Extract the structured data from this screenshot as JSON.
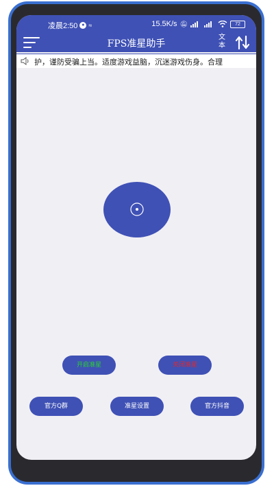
{
  "status_bar": {
    "time": "凌晨2:50",
    "network_speed": "15.5K/s",
    "battery": "72",
    "icons": [
      "qq-notification-icon",
      "app-notification-icon",
      "silent-icon",
      "signal-icon",
      "wifi-icon",
      "battery-icon"
    ]
  },
  "app_bar": {
    "title": "FPS准星助手",
    "text_button_line1": "文",
    "text_button_line2": "本",
    "icons": [
      "menu-icon",
      "swap-vertical-icon"
    ]
  },
  "notice": {
    "text": "护，谨防受骗上当。适度游戏益脑，沉迷游戏伤身。合理"
  },
  "buttons": {
    "enable_crosshair": "开启准星",
    "disable_crosshair": "关闭准星",
    "official_qq_group": "官方Q群",
    "crosshair_settings": "准星设置",
    "official_douyin": "官方抖音"
  },
  "colors": {
    "primary": "#3f51b5",
    "background": "#f0eff4",
    "enable_text": "#29d42f",
    "disable_text": "#e0282d",
    "phone_frame": "#3a6fd0"
  }
}
